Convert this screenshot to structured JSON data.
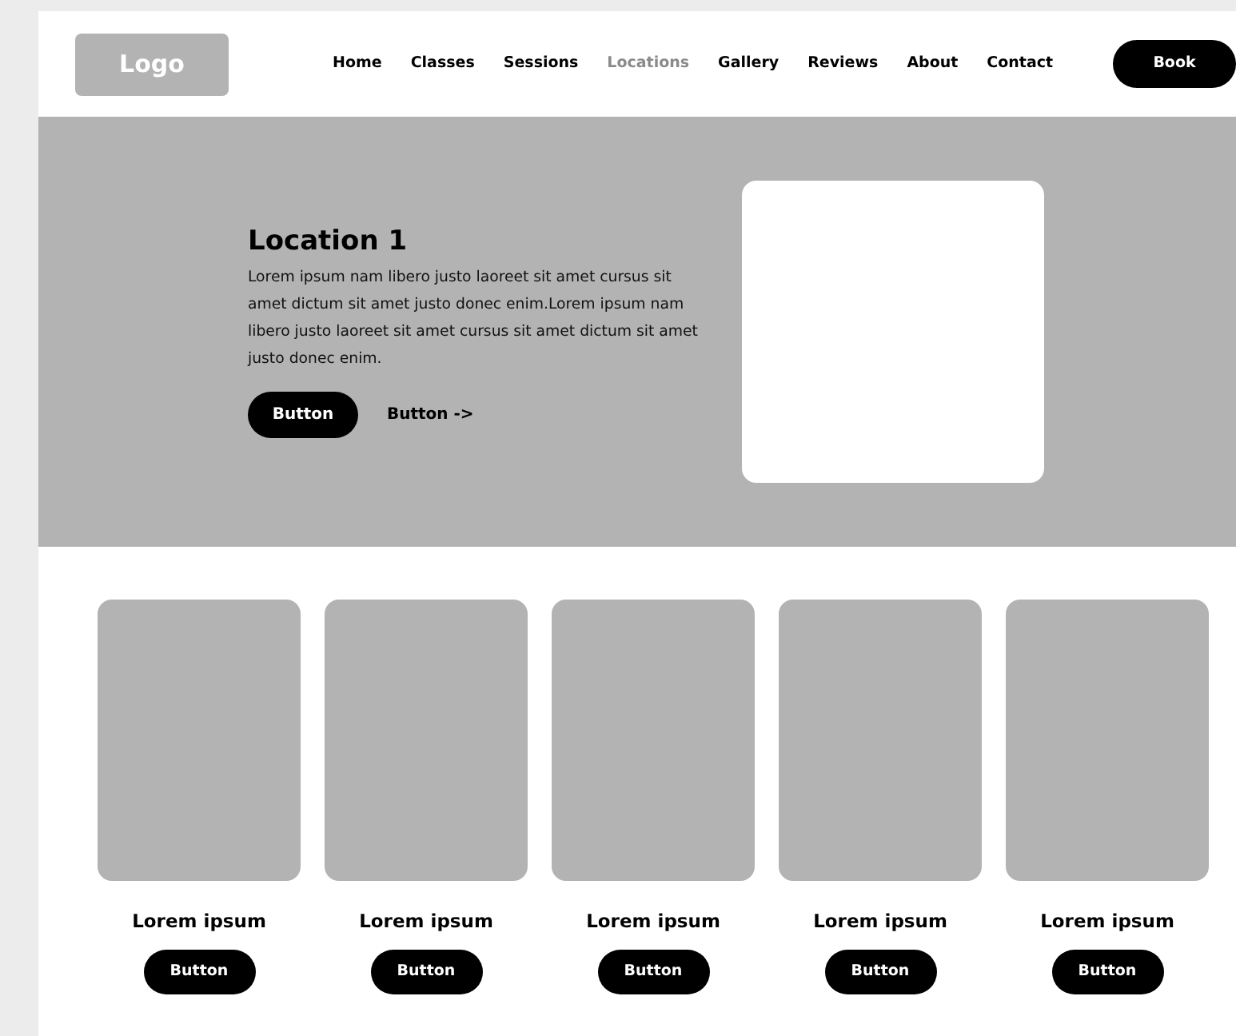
{
  "logo": "Logo",
  "nav": [
    {
      "label": "Home",
      "selected": false
    },
    {
      "label": "Classes",
      "selected": false
    },
    {
      "label": "Sessions",
      "selected": false
    },
    {
      "label": "Locations",
      "selected": true
    },
    {
      "label": "Gallery",
      "selected": false
    },
    {
      "label": "Reviews",
      "selected": false
    },
    {
      "label": "About",
      "selected": false
    },
    {
      "label": "Contact",
      "selected": false
    }
  ],
  "nav_button": "Book",
  "hero": {
    "title": "Location 1",
    "text": "Lorem ipsum nam libero justo laoreet sit amet cursus sit amet dictum sit amet justo donec enim.Lorem ipsum nam libero justo laoreet sit amet cursus sit amet dictum sit amet justo donec enim.",
    "primary_button": "Button",
    "secondary_button": "Button ->"
  },
  "cards": [
    {
      "title": "Lorem ipsum",
      "button": "Button"
    },
    {
      "title": "Lorem ipsum",
      "button": "Button"
    },
    {
      "title": "Lorem ipsum",
      "button": "Button"
    },
    {
      "title": "Lorem ipsum",
      "button": "Button"
    },
    {
      "title": "Lorem ipsum",
      "button": "Button"
    }
  ]
}
